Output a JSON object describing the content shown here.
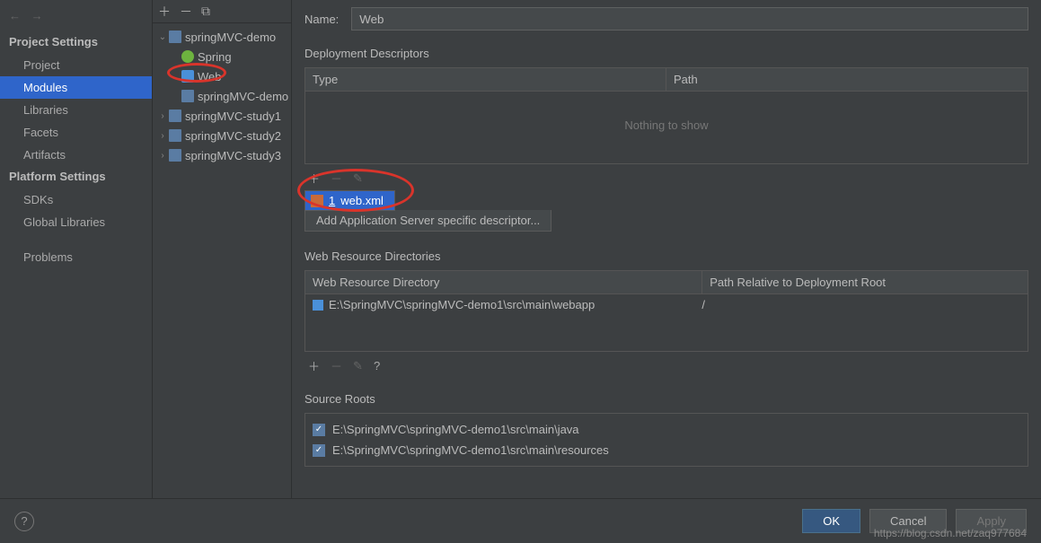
{
  "sidebar": {
    "section1_title": "Project Settings",
    "section1_items": [
      "Project",
      "Modules",
      "Libraries",
      "Facets",
      "Artifacts"
    ],
    "section2_title": "Platform Settings",
    "section2_items": [
      "SDKs",
      "Global Libraries"
    ],
    "section3_items": [
      "Problems"
    ]
  },
  "tree": {
    "root": "springMVC-demo",
    "children": [
      {
        "label": "Spring",
        "icon": "spring"
      },
      {
        "label": "Web",
        "icon": "web"
      }
    ],
    "siblings": [
      "springMVC-demo",
      "springMVC-study1",
      "springMVC-study2",
      "springMVC-study3"
    ]
  },
  "content": {
    "name_label": "Name:",
    "name_value": "Web",
    "deployment_title": "Deployment Descriptors",
    "deployment_headers": [
      "Type",
      "Path"
    ],
    "nothing_text": "Nothing to show",
    "popup_item1_num": "1",
    "popup_item1_label": "web.xml",
    "popup_item2": "Add Application Server specific descriptor...",
    "webres_title": "Web Resource Directories",
    "webres_headers": [
      "Web Resource Directory",
      "Path Relative to Deployment Root"
    ],
    "webres_row": {
      "dir": "E:\\SpringMVC\\springMVC-demo1\\src\\main\\webapp",
      "path": "/"
    },
    "source_title": "Source Roots",
    "source_roots": [
      "E:\\SpringMVC\\springMVC-demo1\\src\\main\\java",
      "E:\\SpringMVC\\springMVC-demo1\\src\\main\\resources"
    ]
  },
  "buttons": {
    "ok": "OK",
    "cancel": "Cancel",
    "apply": "Apply"
  },
  "watermark": "https://blog.csdn.net/zaq977684"
}
